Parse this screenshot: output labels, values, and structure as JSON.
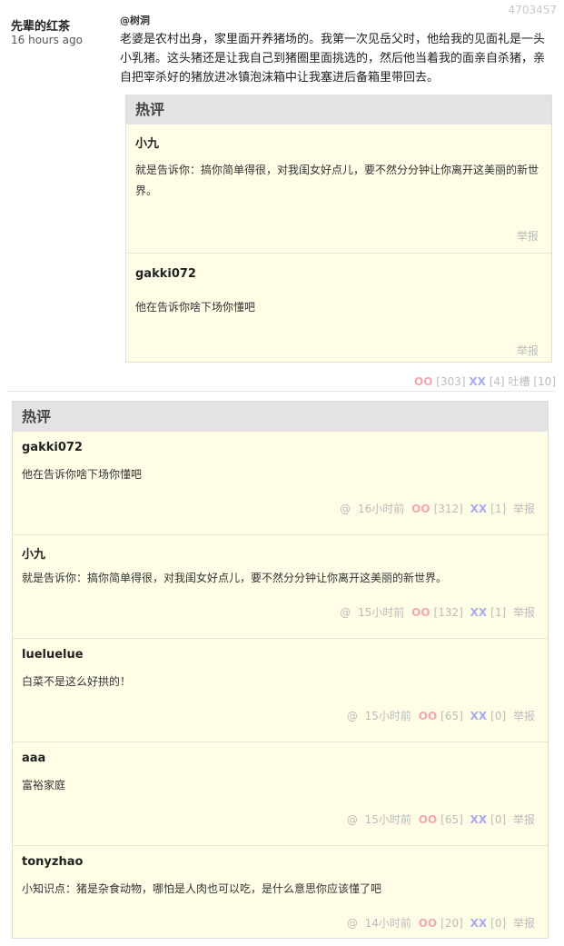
{
  "post": {
    "id": "4703457",
    "author": "先辈的红茶",
    "time": "16 hours ago",
    "mention": "@树洞",
    "text": "老婆是农村出身，家里面开养猪场的。我第一次见岳父时，他给我的见面礼是一头小乳猪。这头猪还是让我自己到猪圈里面挑选的，然后他当着我的面亲自杀猪，亲自把宰杀好的猪放进冰镇泡沫箱中让我塞进后备箱里带回去。",
    "oo_label": "OO",
    "oo_count": "[303]",
    "xx_label": "XX",
    "xx_count": "[4]",
    "tucao": "吐槽 [10]"
  },
  "inner_hot": {
    "title": "热评",
    "comments": [
      {
        "user": "小九",
        "text": "就是告诉你：搞你简单得很，对我闺女好点儿，要不然分分钟让你离开这美丽的新世界。",
        "report": "举报"
      },
      {
        "user": "gakki072",
        "text": "他在告诉你啥下场你懂吧",
        "report": "举报"
      }
    ]
  },
  "hot": {
    "title": "热评",
    "comments": [
      {
        "user": "gakki072",
        "text": "他在告诉你啥下场你懂吧",
        "reply": "@",
        "time": "16小时前",
        "oo": "OO",
        "oo_count": "[312]",
        "xx": "XX",
        "xx_count": "[1]",
        "report": "举报"
      },
      {
        "user": "小九",
        "text": "就是告诉你：搞你简单得很，对我闺女好点儿，要不然分分钟让你离开这美丽的新世界。",
        "reply": "@",
        "time": "15小时前",
        "oo": "OO",
        "oo_count": "[132]",
        "xx": "XX",
        "xx_count": "[1]",
        "report": "举报"
      },
      {
        "user": "lueluelue",
        "text": "白菜不是这么好拱的！",
        "reply": "@",
        "time": "15小时前",
        "oo": "OO",
        "oo_count": "[65]",
        "xx": "XX",
        "xx_count": "[0]",
        "report": "举报"
      },
      {
        "user": "aaa",
        "text": "富裕家庭",
        "reply": "@",
        "time": "15小时前",
        "oo": "OO",
        "oo_count": "[65]",
        "xx": "XX",
        "xx_count": "[0]",
        "report": "举报"
      },
      {
        "user": "tonyzhao",
        "text": "小知识点：猪是杂食动物，哪怕是人肉也可以吃，是什么意思你应该懂了吧",
        "reply": "@",
        "time": "14小时前",
        "oo": "OO",
        "oo_count": "[20]",
        "xx": "XX",
        "xx_count": "[0]",
        "report": "举报"
      }
    ]
  },
  "colors": {
    "oo": "#f2a7b1",
    "xx": "#a9a9f1",
    "hot_bg": "#fefee6",
    "title_bg": "#e3e3e3"
  }
}
